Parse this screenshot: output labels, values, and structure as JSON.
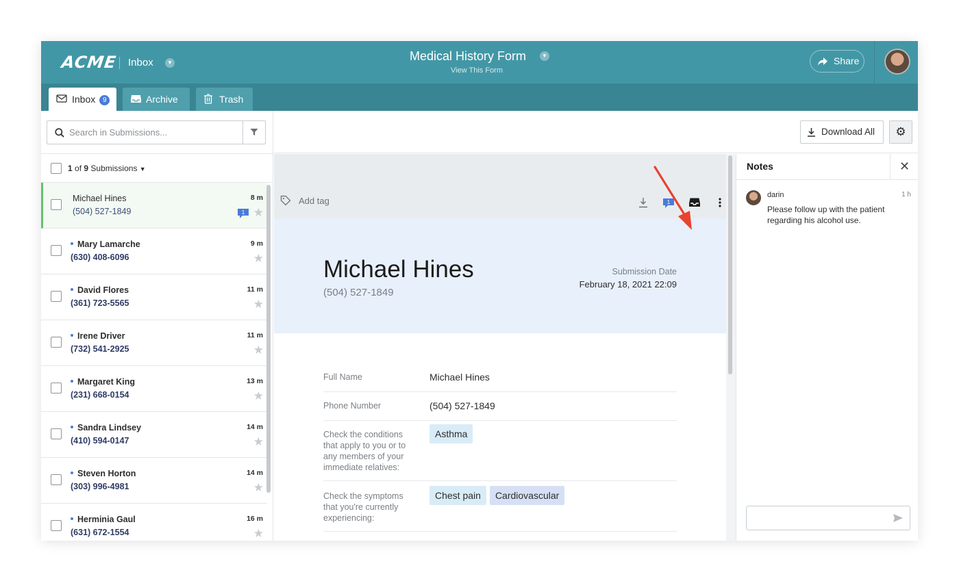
{
  "header": {
    "logo": "ACME",
    "section": "Inbox",
    "form_title": "Medical History Form",
    "form_link": "View This Form",
    "share_label": "Share"
  },
  "tabs": [
    {
      "label": "Inbox",
      "badge": "9",
      "icon": "envelope-icon",
      "active": true
    },
    {
      "label": "Archive",
      "icon": "archive-tray-icon",
      "active": false
    },
    {
      "label": "Trash",
      "icon": "trash-icon",
      "active": false
    }
  ],
  "search": {
    "placeholder": "Search in Submissions..."
  },
  "selection": {
    "current": "1",
    "of": "of",
    "total": "9",
    "label": "Submissions"
  },
  "submissions": [
    {
      "name": "Michael Hines",
      "phone": "(504) 527-1849",
      "time": "8 m",
      "selected": true,
      "unread": false,
      "comments": "1"
    },
    {
      "name": "Mary Lamarche",
      "phone": "(630) 408-6096",
      "time": "9 m",
      "selected": false,
      "unread": true
    },
    {
      "name": "David Flores",
      "phone": "(361) 723-5565",
      "time": "11 m",
      "selected": false,
      "unread": true
    },
    {
      "name": "Irene Driver",
      "phone": "(732) 541-2925",
      "time": "11 m",
      "selected": false,
      "unread": true
    },
    {
      "name": "Margaret King",
      "phone": "(231) 668-0154",
      "time": "13 m",
      "selected": false,
      "unread": true
    },
    {
      "name": "Sandra Lindsey",
      "phone": "(410) 594-0147",
      "time": "14 m",
      "selected": false,
      "unread": true
    },
    {
      "name": "Steven Horton",
      "phone": "(303) 996-4981",
      "time": "14 m",
      "selected": false,
      "unread": true
    },
    {
      "name": "Herminia Gaul",
      "phone": "(631) 672-1554",
      "time": "16 m",
      "selected": false,
      "unread": true
    }
  ],
  "toolbar": {
    "download_all": "Download All",
    "add_tag": "Add tag",
    "comment_count": "1"
  },
  "submission": {
    "name": "Michael Hines",
    "phone": "(504) 527-1849",
    "date_label": "Submission Date",
    "date_value": "February 18, 2021 22:09",
    "fields": [
      {
        "label": "Full Name",
        "value": "Michael Hines"
      },
      {
        "label": "Phone Number",
        "value": "(504) 527-1849"
      },
      {
        "label": "Check the conditions that apply to you or to any members of your immediate relatives:",
        "chips": [
          "Asthma"
        ]
      },
      {
        "label": "Check the symptoms that you're currently experiencing:",
        "chips": [
          "Chest pain",
          "Cardiovascular"
        ]
      }
    ]
  },
  "notes": {
    "title": "Notes",
    "items": [
      {
        "author": "darin",
        "time": "1 h",
        "text": "Please follow up with the patient regarding his alcohol use."
      }
    ],
    "input_placeholder": ""
  },
  "colors": {
    "header": "#4297a6",
    "tabbar": "#3a8593",
    "accent_blue": "#4a7bd8",
    "selected_green": "#63c06b",
    "annotation_arrow": "#e8432e"
  }
}
